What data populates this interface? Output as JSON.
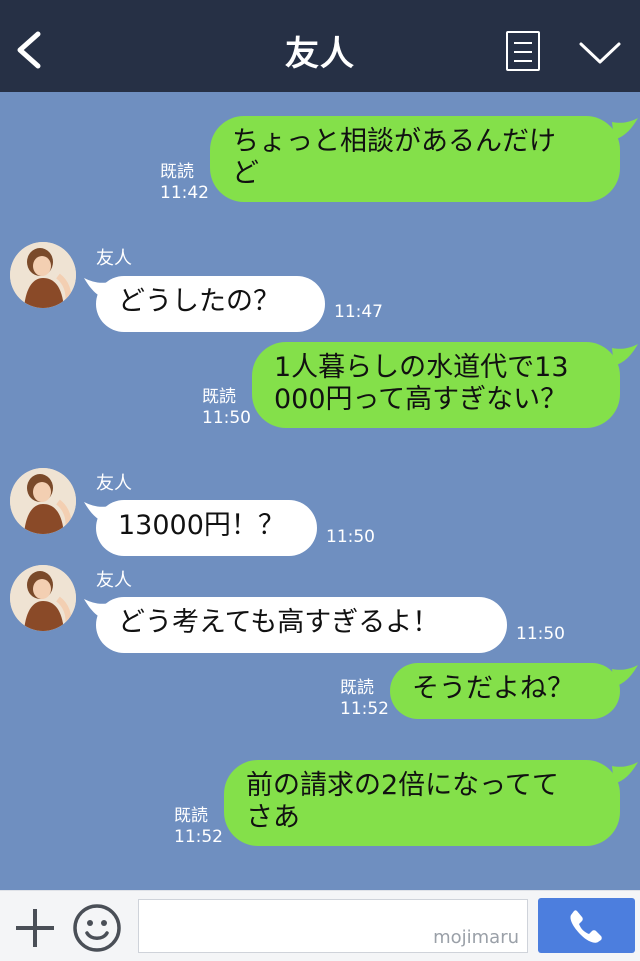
{
  "header": {
    "title": "友人",
    "back_icon": "chevron-left-icon",
    "menu_icon": "menu-icon",
    "collapse_icon": "chevron-down-icon",
    "background": "#263045"
  },
  "chat": {
    "background": "#6f8fc0",
    "outgoing_color": "#84e04a",
    "incoming_color": "#ffffff",
    "messages": [
      {
        "direction": "out",
        "lines": [
          "ちょっと相談があるんだけ",
          "ど"
        ],
        "read": "既読",
        "time": "11:42"
      },
      {
        "direction": "in",
        "sender": "友人",
        "lines": [
          "どうしたの？"
        ],
        "time": "11:47"
      },
      {
        "direction": "out",
        "lines": [
          "1人暮らしの水道代で13",
          "000円って高すぎない？"
        ],
        "read": "既読",
        "time": "11:50"
      },
      {
        "direction": "in",
        "sender": "友人",
        "lines": [
          "13000円！？"
        ],
        "time": "11:50"
      },
      {
        "direction": "in",
        "sender": "友人",
        "lines": [
          "どう考えても高すぎるよ！"
        ],
        "time": "11:50"
      },
      {
        "direction": "out",
        "lines": [
          "そうだよね？"
        ],
        "read": "既読",
        "time": "11:52"
      },
      {
        "direction": "out",
        "lines": [
          "前の請求の2倍になってて",
          "さあ"
        ],
        "read": "既読",
        "time": "11:52"
      }
    ]
  },
  "footer": {
    "plus_icon": "plus-icon",
    "emoji_icon": "smile-icon",
    "input_value": "",
    "watermark": "mojimaru",
    "call_icon": "phone-icon",
    "call_color": "#4c7ede"
  }
}
